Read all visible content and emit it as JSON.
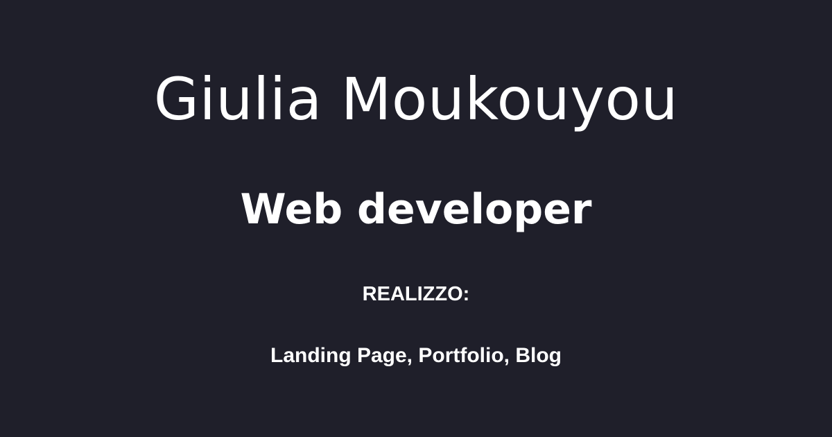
{
  "background_color": "#1f1f2a",
  "text_color": "#ffffff",
  "name": "Giulia Moukouyou",
  "role": "Web developer",
  "kicker": "REALIZZO:",
  "services": "Landing Page, Portfolio, Blog"
}
